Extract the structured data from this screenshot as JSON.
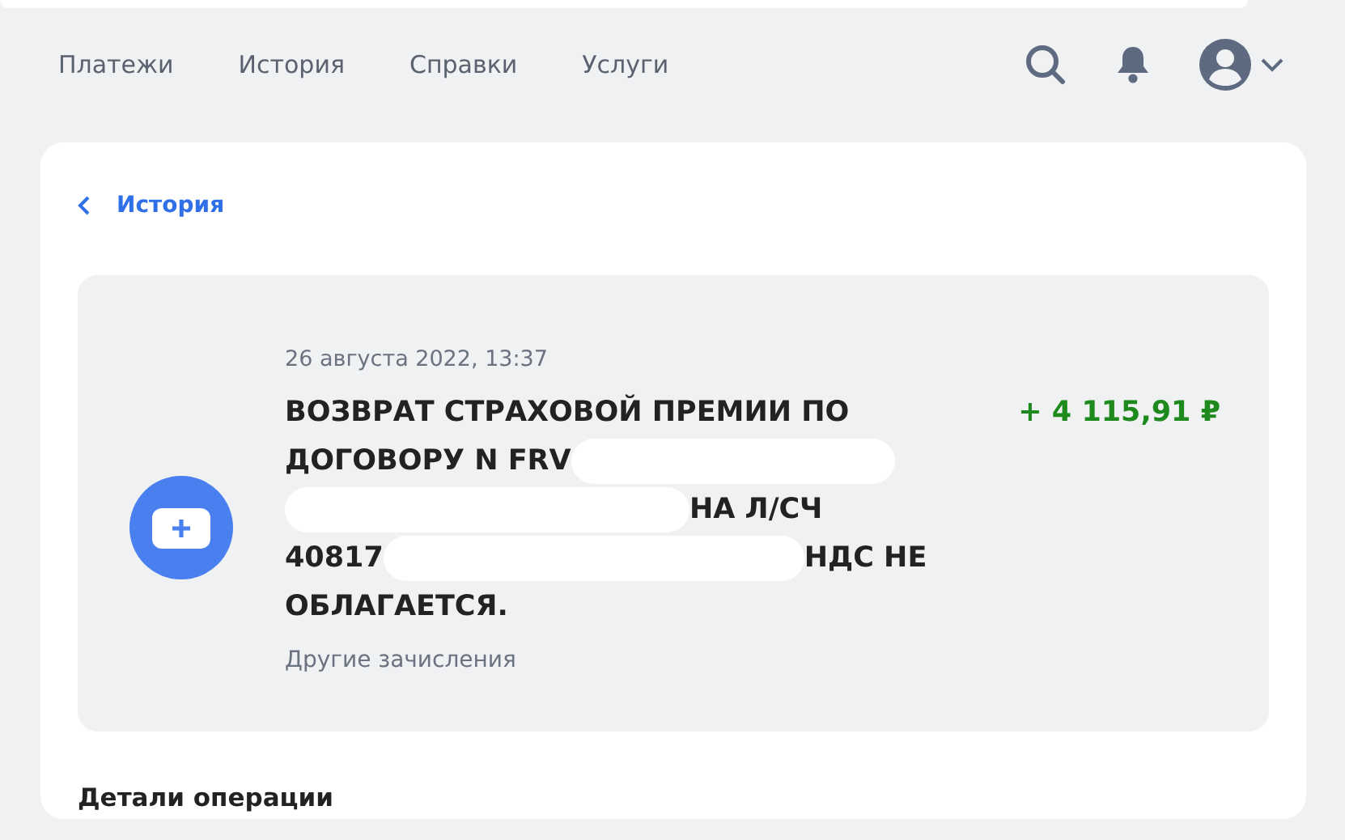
{
  "nav": {
    "items": [
      {
        "label": "Платежи"
      },
      {
        "label": "История"
      },
      {
        "label": "Справки"
      },
      {
        "label": "Услуги"
      }
    ]
  },
  "back_link": {
    "label": "История"
  },
  "operation": {
    "date": "26 августа 2022, 13:37",
    "title_lines": [
      [
        {
          "kind": "text",
          "text": "ВОЗВРАТ СТРАХОВОЙ ПРЕМИИ ПО"
        }
      ],
      [
        {
          "kind": "text",
          "text": "ДОГОВОРУ N FRV"
        },
        {
          "kind": "redaction"
        }
      ],
      [
        {
          "kind": "redaction"
        },
        {
          "kind": "text",
          "text": "НА Л/СЧ"
        }
      ],
      [
        {
          "kind": "text",
          "text": "40817"
        },
        {
          "kind": "redaction"
        },
        {
          "kind": "text",
          "text": "НДС НЕ"
        }
      ],
      [
        {
          "kind": "text",
          "text": "ОБЛАГАЕТСЯ."
        }
      ]
    ],
    "amount": "+ 4 115,91 ₽",
    "category": "Другие зачисления"
  },
  "details_heading": "Детали операции"
}
